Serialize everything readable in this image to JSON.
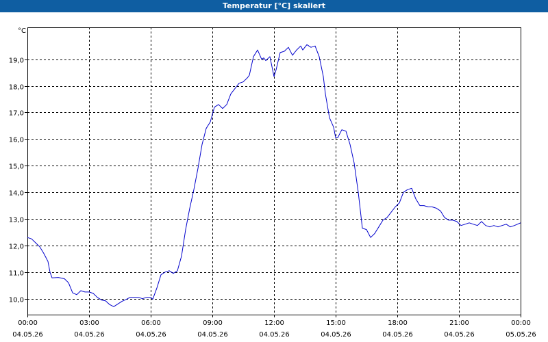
{
  "window": {
    "title": "Temperatur [°C] skaliert"
  },
  "chart_data": {
    "type": "line",
    "title": "Temperatur [°C] skaliert",
    "unit_label": "°C",
    "xlabel": "",
    "ylabel": "°C",
    "xlim_hours": [
      0,
      24
    ],
    "ylim": [
      9.4,
      20.2
    ],
    "yticks": [
      {
        "value": 10.0,
        "label": "10,0"
      },
      {
        "value": 11.0,
        "label": "11,0"
      },
      {
        "value": 12.0,
        "label": "12,0"
      },
      {
        "value": 13.0,
        "label": "13,0"
      },
      {
        "value": 14.0,
        "label": "14,0"
      },
      {
        "value": 15.0,
        "label": "15,0"
      },
      {
        "value": 16.0,
        "label": "16,0"
      },
      {
        "value": 17.0,
        "label": "17,0"
      },
      {
        "value": 18.0,
        "label": "18,0"
      },
      {
        "value": 19.0,
        "label": "19,0"
      }
    ],
    "xticks": [
      {
        "hour": 0,
        "time": "00:00",
        "date": "04.05.26"
      },
      {
        "hour": 3,
        "time": "03:00",
        "date": "04.05.26"
      },
      {
        "hour": 6,
        "time": "06:00",
        "date": "04.05.26"
      },
      {
        "hour": 9,
        "time": "09:00",
        "date": "04.05.26"
      },
      {
        "hour": 12,
        "time": "12:00",
        "date": "04.05.26"
      },
      {
        "hour": 15,
        "time": "15:00",
        "date": "04.05.26"
      },
      {
        "hour": 18,
        "time": "18:00",
        "date": "04.05.26"
      },
      {
        "hour": 21,
        "time": "21:00",
        "date": "04.05.26"
      },
      {
        "hour": 24,
        "time": "00:00",
        "date": "05.05.26"
      }
    ],
    "grid": true,
    "series": [
      {
        "color": "#0000cc",
        "x_hours": [
          0,
          0.2,
          0.4,
          0.6,
          0.8,
          1.0,
          1.1,
          1.2,
          1.5,
          1.8,
          2.0,
          2.2,
          2.4,
          2.6,
          2.8,
          3.0,
          3.2,
          3.4,
          3.6,
          3.8,
          4.0,
          4.2,
          4.4,
          4.6,
          4.8,
          5.0,
          5.2,
          5.4,
          5.6,
          5.8,
          6.0,
          6.1,
          6.3,
          6.5,
          6.7,
          6.9,
          7.1,
          7.3,
          7.5,
          7.7,
          7.9,
          8.1,
          8.3,
          8.5,
          8.7,
          8.9,
          9.1,
          9.3,
          9.5,
          9.7,
          9.9,
          10.1,
          10.3,
          10.5,
          10.7,
          10.8,
          10.9,
          11.0,
          11.2,
          11.4,
          11.5,
          11.6,
          11.8,
          12.0,
          12.1,
          12.3,
          12.5,
          12.7,
          12.9,
          13.1,
          13.3,
          13.4,
          13.6,
          13.8,
          14.0,
          14.2,
          14.4,
          14.5,
          14.7,
          14.9,
          15.0,
          15.1,
          15.3,
          15.5,
          15.7,
          15.9,
          16.1,
          16.3,
          16.5,
          16.7,
          16.9,
          17.1,
          17.3,
          17.5,
          17.7,
          17.9,
          18.1,
          18.3,
          18.5,
          18.7,
          18.9,
          19.1,
          19.3,
          19.5,
          19.7,
          19.9,
          20.1,
          20.3,
          20.5,
          20.7,
          20.9,
          21.1,
          21.3,
          21.5,
          21.7,
          21.9,
          22.1,
          22.3,
          22.5,
          22.7,
          22.9,
          23.1,
          23.3,
          23.5,
          23.7,
          24.0
        ],
        "values": [
          12.3,
          12.25,
          12.1,
          11.95,
          11.7,
          11.4,
          11.0,
          10.78,
          10.8,
          10.75,
          10.6,
          10.22,
          10.15,
          10.3,
          10.25,
          10.25,
          10.2,
          10.05,
          9.95,
          9.92,
          9.78,
          9.7,
          9.8,
          9.9,
          9.97,
          10.05,
          10.05,
          10.05,
          10.0,
          10.05,
          10.05,
          9.98,
          10.4,
          10.9,
          11.0,
          11.05,
          10.95,
          11.05,
          11.6,
          12.6,
          13.4,
          14.1,
          14.9,
          15.8,
          16.4,
          16.65,
          17.2,
          17.3,
          17.15,
          17.3,
          17.7,
          17.9,
          18.1,
          18.15,
          18.3,
          18.4,
          18.75,
          19.1,
          19.35,
          19.0,
          19.05,
          18.95,
          19.1,
          18.35,
          18.6,
          19.25,
          19.3,
          19.45,
          19.15,
          19.35,
          19.5,
          19.35,
          19.55,
          19.45,
          19.5,
          19.1,
          18.35,
          17.7,
          16.8,
          16.45,
          16.05,
          16.05,
          16.35,
          16.3,
          15.8,
          15.1,
          14.0,
          12.65,
          12.6,
          12.3,
          12.45,
          12.7,
          12.95,
          13.05,
          13.25,
          13.45,
          13.6,
          14.0,
          14.1,
          14.15,
          13.75,
          13.5,
          13.5,
          13.45,
          13.45,
          13.4,
          13.3,
          13.05,
          12.95,
          12.95,
          12.9,
          12.75,
          12.8,
          12.85,
          12.8,
          12.75,
          12.9,
          12.75,
          12.7,
          12.75,
          12.7,
          12.75,
          12.8,
          12.7,
          12.75,
          12.85,
          12.75,
          12.5
        ]
      }
    ]
  }
}
